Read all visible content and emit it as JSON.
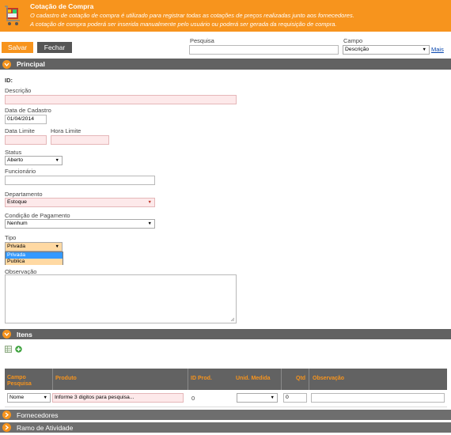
{
  "header": {
    "title": "Cotação de Compra",
    "desc_line1": "O cadastro de cotação de compra é utilizado para registrar todas as cotações de preços realizadas junto aos fornecedores.",
    "desc_line2": "A cotação de compra poderá ser inserida manualmente pelo usuário ou poderá ser gerada da requisição de compra.",
    "icon": "shopping-cart-icon"
  },
  "toolbar": {
    "save_label": "Salvar",
    "close_label": "Fechar"
  },
  "search": {
    "label": "Pesquisa",
    "value": "",
    "field_label": "Campo",
    "field_value": "Descrição",
    "more_label": "Mais"
  },
  "sections": {
    "principal": "Principal",
    "itens": "Itens",
    "fornecedores": "Fornecedores",
    "ramo": "Ramo de Atividade"
  },
  "form": {
    "id_label": "ID:",
    "descricao_label": "Descrição",
    "descricao_value": "",
    "data_cadastro_label": "Data de Cadastro",
    "data_cadastro_value": "01/04/2014",
    "data_limite_label": "Data Limite",
    "hora_limite_label": "Hora Limite",
    "status_label": "Status",
    "status_value": "Aberto",
    "funcionario_label": "Funcionário",
    "departamento_label": "Departamento",
    "departamento_value": "Estoque",
    "condicao_label": "Condição de Pagamento",
    "condicao_value": "Nenhum",
    "tipo_label": "Tipo",
    "tipo_value": "Privada",
    "tipo_options": [
      "Privada",
      "Publica"
    ],
    "observacao_label": "Observação"
  },
  "items_table": {
    "headers": {
      "campo": "Campo Pesquisa",
      "produto": "Produto",
      "id_prod": "ID Prod.",
      "unid": "Unid. Medida",
      "qtd": "Qtd",
      "obs": "Observação"
    },
    "row": {
      "campo_value": "Nome",
      "produto_placeholder": "Informe 3 digitos para pesquisa...",
      "id_prod": "0",
      "unid_value": "",
      "qtd": "0",
      "obs": ""
    }
  },
  "colors": {
    "accent": "#f7941d",
    "bar": "#626262",
    "required_field": "#fde9ea"
  }
}
